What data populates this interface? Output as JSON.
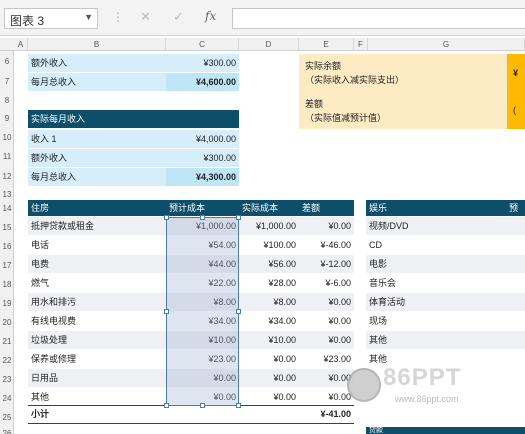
{
  "formula_bar": {
    "name_box": "图表 3",
    "fx_label": "fx",
    "cancel_icon": "✕",
    "enter_icon": "✓",
    "formula_value": ""
  },
  "columns": [
    "A",
    "B",
    "C",
    "D",
    "E",
    "F",
    "G"
  ],
  "rows": [
    "6",
    "7",
    "8",
    "9",
    "10",
    "11",
    "12",
    "13",
    "14",
    "15",
    "16",
    "17",
    "18",
    "19",
    "20",
    "21",
    "22",
    "23",
    "24",
    "25",
    "26"
  ],
  "top_income": [
    {
      "label": "额外收入",
      "value": "¥300.00"
    },
    {
      "label": "每月总收入",
      "value": "¥4,600.00"
    }
  ],
  "actual_income": {
    "title": "实际每月收入",
    "rows": [
      {
        "label": "收入 1",
        "value": "¥4,000.00"
      },
      {
        "label": "额外收入",
        "value": "¥300.00"
      },
      {
        "label": "每月总收入",
        "value": "¥4,300.00"
      }
    ]
  },
  "summary": {
    "balance_title": "实际余额",
    "balance_sub": "（实际收入减实际支出）",
    "balance_value": "¥",
    "diff_title": "差额",
    "diff_sub": "（实际值减预计值）",
    "diff_value": "("
  },
  "housing": {
    "headers": [
      "住房",
      "预计成本",
      "实际成本",
      "差额"
    ],
    "rows": [
      [
        "抵押贷款或租金",
        "¥1,000.00",
        "¥1,000.00",
        "¥0.00"
      ],
      [
        "电话",
        "¥54.00",
        "¥100.00",
        "¥-46.00"
      ],
      [
        "电费",
        "¥44.00",
        "¥56.00",
        "¥-12.00"
      ],
      [
        "燃气",
        "¥22.00",
        "¥28.00",
        "¥-6.00"
      ],
      [
        "用水和排污",
        "¥8.00",
        "¥8.00",
        "¥0.00"
      ],
      [
        "有线电视费",
        "¥34.00",
        "¥34.00",
        "¥0.00"
      ],
      [
        "垃圾处理",
        "¥10.00",
        "¥10.00",
        "¥0.00"
      ],
      [
        "保养或修理",
        "¥23.00",
        "¥0.00",
        "¥23.00"
      ],
      [
        "日用品",
        "¥0.00",
        "¥0.00",
        "¥0.00"
      ],
      [
        "其他",
        "¥0.00",
        "¥0.00",
        "¥0.00"
      ]
    ],
    "subtotal_label": "小计",
    "subtotal_value": "¥-41.00"
  },
  "entertainment": {
    "headers": [
      "娱乐",
      "预计"
    ],
    "rows": [
      "视频/DVD",
      "CD",
      "电影",
      "音乐会",
      "体育活动",
      "现场",
      "其他",
      "其他"
    ],
    "last_partial": "贷款"
  },
  "watermark": {
    "brand": "86PPT",
    "url": "www.86ppt.com"
  }
}
